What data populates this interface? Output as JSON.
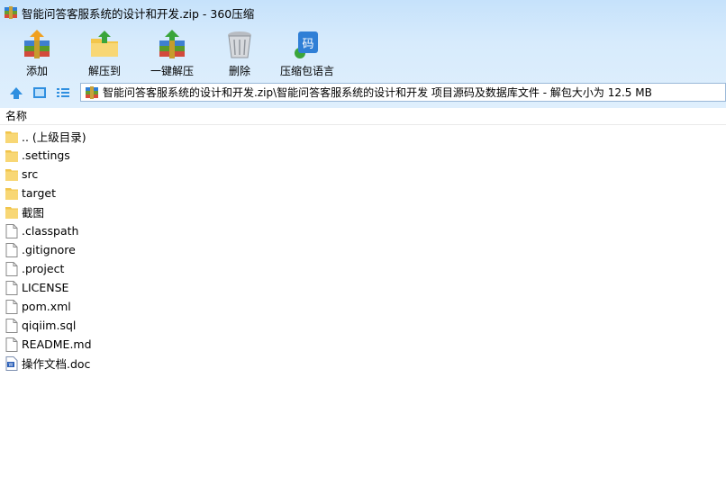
{
  "window": {
    "title": "智能问答客服系统的设计和开发.zip - 360压缩"
  },
  "toolbar": {
    "buttons": [
      {
        "label": "添加",
        "icon": "add-archive-icon"
      },
      {
        "label": "解压到",
        "icon": "extract-to-icon"
      },
      {
        "label": "一键解压",
        "icon": "one-click-extract-icon"
      },
      {
        "label": "删除",
        "icon": "trash-icon"
      },
      {
        "label": "压缩包语言",
        "icon": "encoding-icon",
        "icon_text": "码"
      }
    ]
  },
  "address": {
    "path": "智能问答客服系统的设计和开发.zip\\智能问答客服系统的设计和开发 项目源码及数据库文件 - 解包大小为 12.5 MB"
  },
  "list": {
    "column_name": "名称",
    "items": [
      {
        "name": ".. (上级目录)",
        "type": "folder"
      },
      {
        "name": ".settings",
        "type": "folder"
      },
      {
        "name": "src",
        "type": "folder"
      },
      {
        "name": "target",
        "type": "folder"
      },
      {
        "name": "截图",
        "type": "folder"
      },
      {
        "name": ".classpath",
        "type": "file"
      },
      {
        "name": ".gitignore",
        "type": "file"
      },
      {
        "name": ".project",
        "type": "file"
      },
      {
        "name": "LICENSE",
        "type": "file"
      },
      {
        "name": "pom.xml",
        "type": "file"
      },
      {
        "name": "qiqiim.sql",
        "type": "file"
      },
      {
        "name": "README.md",
        "type": "file"
      },
      {
        "name": "操作文档.doc",
        "type": "doc"
      }
    ]
  },
  "colors": {
    "toolbar_bg": "#d7ebfc",
    "folder": "#f8d775",
    "path_border": "#9ab8d8",
    "accent": "#2f7fd6"
  }
}
